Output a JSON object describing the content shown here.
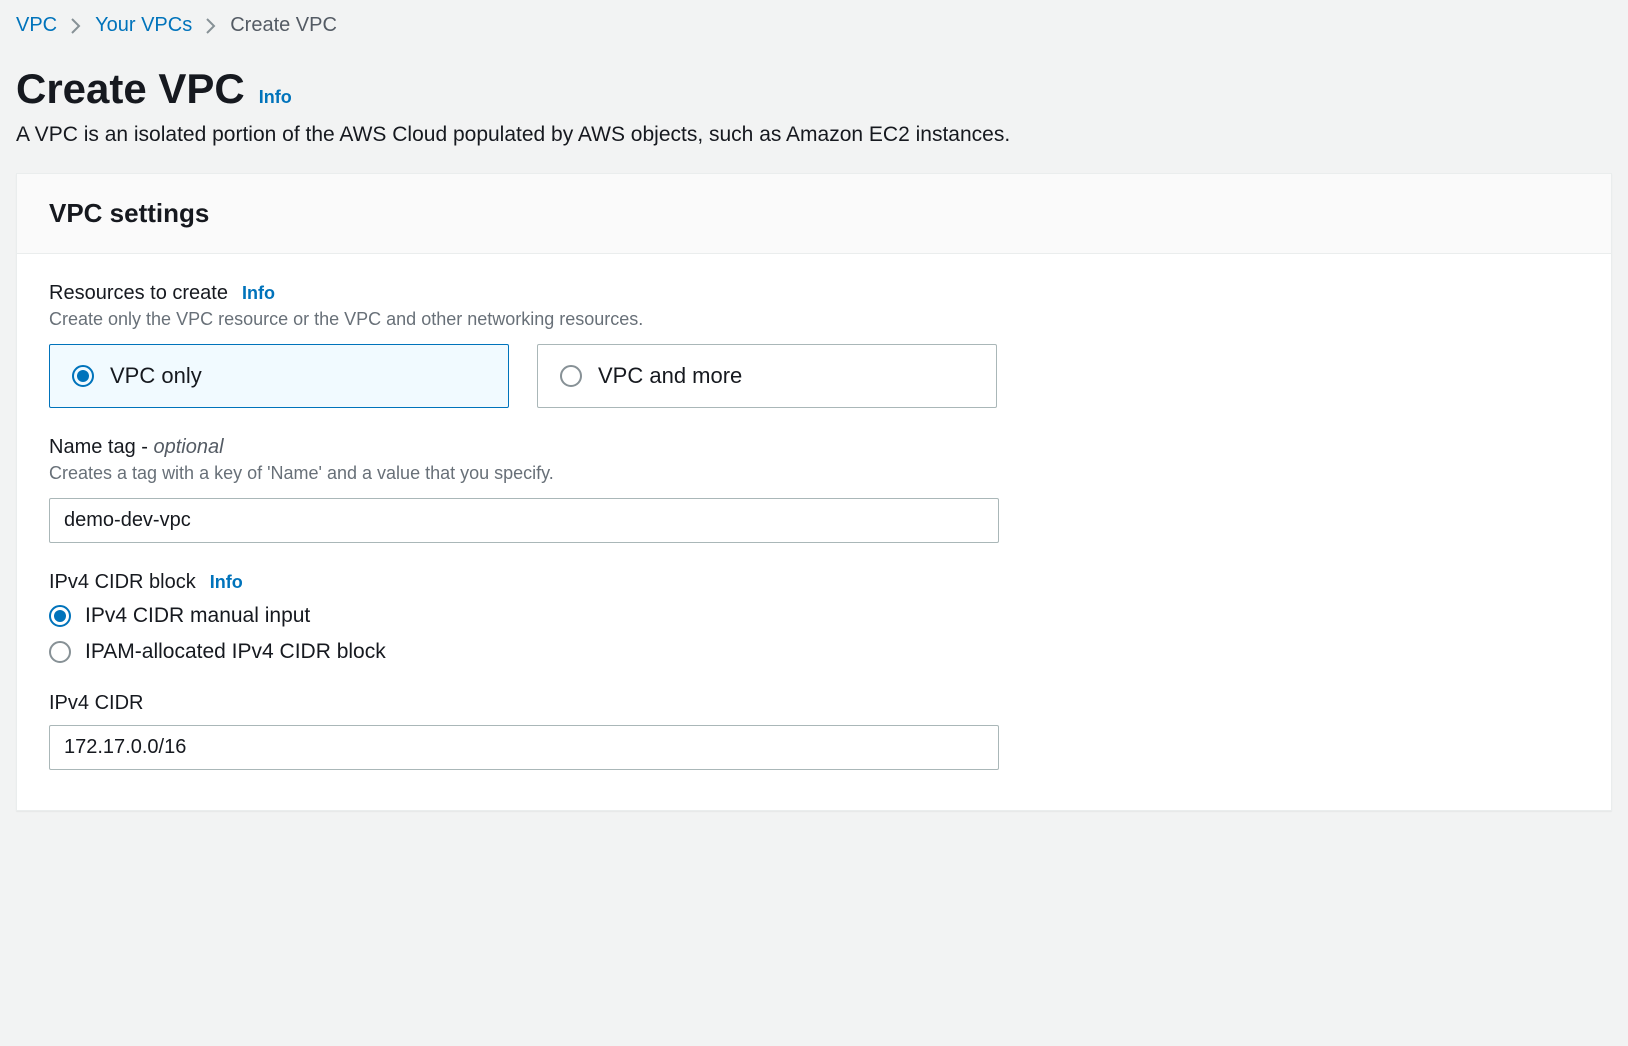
{
  "breadcrumb": {
    "items": [
      "VPC",
      "Your VPCs",
      "Create VPC"
    ]
  },
  "page": {
    "title": "Create VPC",
    "info_label": "Info",
    "subtitle": "A VPC is an isolated portion of the AWS Cloud populated by AWS objects, such as Amazon EC2 instances."
  },
  "panel": {
    "title": "VPC settings"
  },
  "resources_to_create": {
    "label": "Resources to create",
    "info_label": "Info",
    "description": "Create only the VPC resource or the VPC and other networking resources.",
    "options": [
      {
        "label": "VPC only",
        "selected": true
      },
      {
        "label": "VPC and more",
        "selected": false
      }
    ]
  },
  "name_tag": {
    "label": "Name tag - ",
    "optional_text": "optional",
    "description": "Creates a tag with a key of 'Name' and a value that you specify.",
    "value": "demo-dev-vpc"
  },
  "ipv4_cidr_block": {
    "label": "IPv4 CIDR block",
    "info_label": "Info",
    "options": [
      {
        "label": "IPv4 CIDR manual input",
        "selected": true
      },
      {
        "label": "IPAM-allocated IPv4 CIDR block",
        "selected": false
      }
    ]
  },
  "ipv4_cidr": {
    "label": "IPv4 CIDR",
    "value": "172.17.0.0/16"
  }
}
